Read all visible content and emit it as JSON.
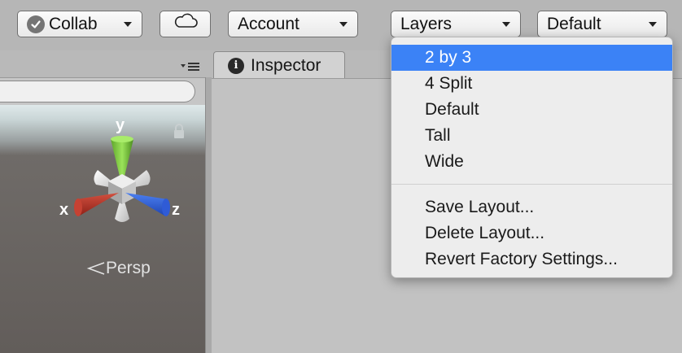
{
  "toolbar": {
    "collab_label": "Collab",
    "account_label": "Account",
    "layers_label": "Layers",
    "layout_label": "Default"
  },
  "panels": {
    "inspector_tab_label": "Inspector"
  },
  "scene": {
    "axis_y": "y",
    "axis_x": "x",
    "axis_z": "z",
    "projection_label": "Persp",
    "colors": {
      "x_axis": "#c4392d",
      "y_axis": "#7cd13a",
      "z_axis": "#3465e0"
    }
  },
  "layout_menu": {
    "items": [
      {
        "label": "2 by 3",
        "selected": true
      },
      {
        "label": "4 Split"
      },
      {
        "label": "Default"
      },
      {
        "label": "Tall"
      },
      {
        "label": "Wide"
      }
    ],
    "actions": [
      {
        "label": "Save Layout..."
      },
      {
        "label": "Delete Layout..."
      },
      {
        "label": "Revert Factory Settings..."
      }
    ],
    "highlight_color": "#3b82f6"
  }
}
